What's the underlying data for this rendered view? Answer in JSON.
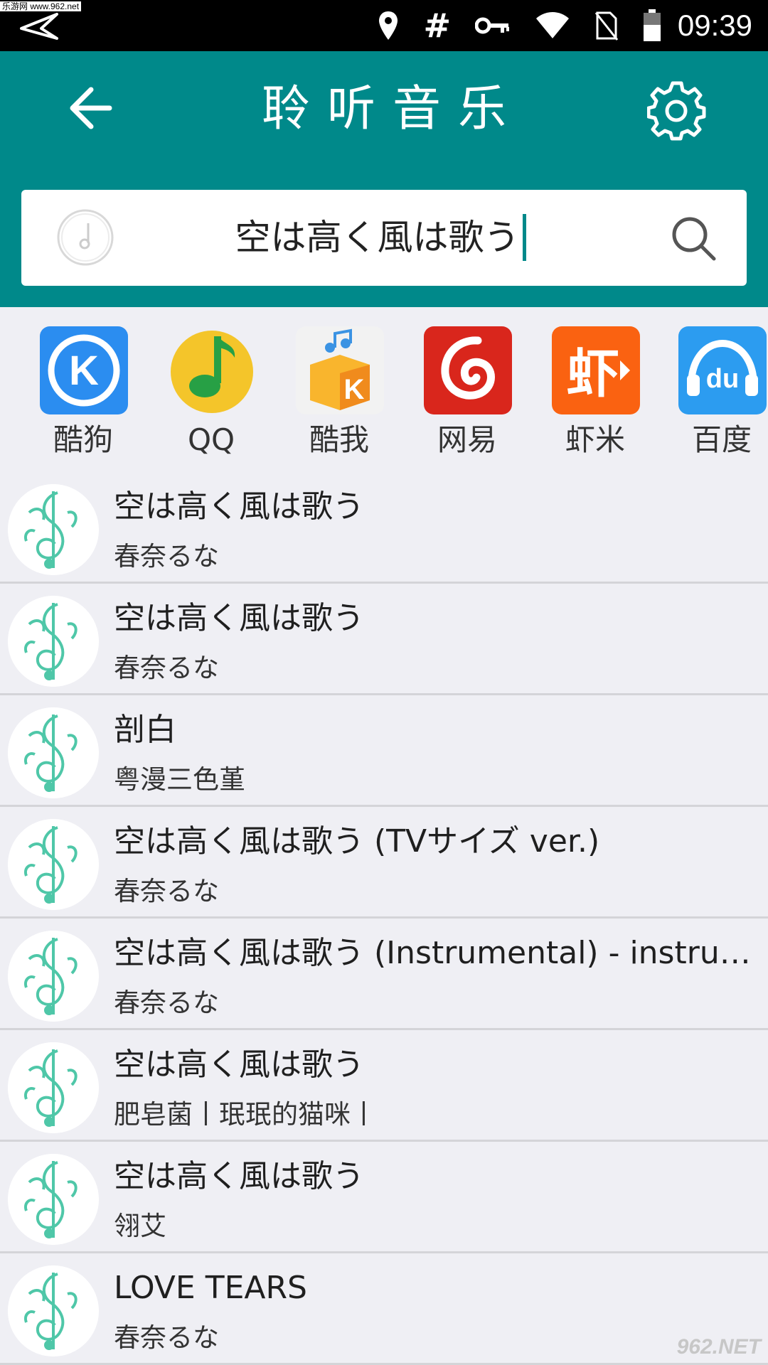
{
  "status_bar": {
    "watermark": "乐游网 www.962.net",
    "time": "09:39",
    "hash_symbol": "#",
    "icons": [
      "back-arrow-icon",
      "location-icon",
      "hash-icon",
      "key-icon",
      "wifi-icon",
      "no-sim-icon",
      "battery-icon"
    ]
  },
  "header": {
    "title": "聆听音乐",
    "background": "#00898a"
  },
  "search": {
    "query": "空は高く風は歌う"
  },
  "sources": [
    {
      "label": "酷狗",
      "icon": "kugou-icon"
    },
    {
      "label": "QQ",
      "icon": "qq-music-icon"
    },
    {
      "label": "酷我",
      "icon": "kuwo-icon"
    },
    {
      "label": "网易",
      "icon": "netease-icon"
    },
    {
      "label": "虾米",
      "icon": "xiami-icon"
    },
    {
      "label": "百度",
      "icon": "baidu-icon"
    }
  ],
  "songs": [
    {
      "title": "空は高く風は歌う",
      "artist": "春奈るな"
    },
    {
      "title": "空は高く風は歌う",
      "artist": "春奈るな"
    },
    {
      "title": "剖白",
      "artist": "粤漫三色堇"
    },
    {
      "title": "空は高く風は歌う (TVサイズ ver.)",
      "artist": "春奈るな"
    },
    {
      "title": "空は高く風は歌う (Instrumental) - instrume...",
      "artist": "春奈るな"
    },
    {
      "title": "空は高く風は歌う",
      "artist": "肥皂菌丨珉珉的猫咪丨"
    },
    {
      "title": "空は高く風は歌う",
      "artist": "翎艾"
    },
    {
      "title": "LOVE TEARS",
      "artist": "春奈るな"
    }
  ],
  "corner_watermark": "962.NET"
}
